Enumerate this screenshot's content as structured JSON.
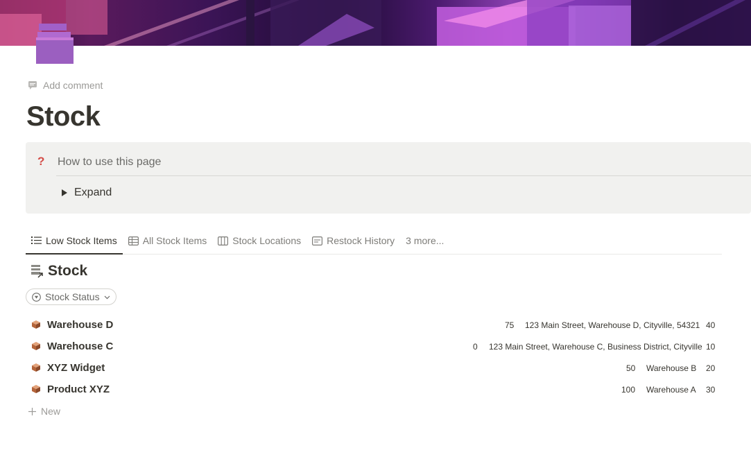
{
  "page": {
    "title": "Stock",
    "add_comment": "Add comment",
    "cover_icon": "isometric-warehouse-cover",
    "page_icon": "stacked-boxes-icon"
  },
  "callout": {
    "icon": "question-mark-icon",
    "heading": "How to use this page",
    "toggle_label": "Expand"
  },
  "tabs": [
    {
      "label": "Low Stock Items",
      "icon": "list-icon",
      "active": true
    },
    {
      "label": "All Stock Items",
      "icon": "table-icon",
      "active": false
    },
    {
      "label": "Stock Locations",
      "icon": "board-icon",
      "active": false
    },
    {
      "label": "Restock History",
      "icon": "calendar-icon",
      "active": false
    },
    {
      "label": "3 more...",
      "icon": "",
      "active": false
    }
  ],
  "database": {
    "title": "Stock",
    "filter_label": "Stock Status",
    "new_label": "New",
    "rows": [
      {
        "name": "Warehouse D",
        "quantity": "75",
        "location": "123 Main Street, Warehouse D, Cityville, 54321",
        "threshold": "40"
      },
      {
        "name": "Warehouse C",
        "quantity": "0",
        "location": "123 Main Street, Warehouse C, Business District, Cityville",
        "threshold": "10"
      },
      {
        "name": "XYZ Widget",
        "quantity": "50",
        "location": "Warehouse B",
        "threshold": "20"
      },
      {
        "name": "Product XYZ",
        "quantity": "100",
        "location": "Warehouse A",
        "threshold": "30"
      }
    ]
  },
  "colors": {
    "accent_text": "#37352f",
    "muted_text": "#9b9a97",
    "callout_bg": "#f1f1ef",
    "question_mark": "#d44c47",
    "page_icon": "#9b5fc0"
  }
}
